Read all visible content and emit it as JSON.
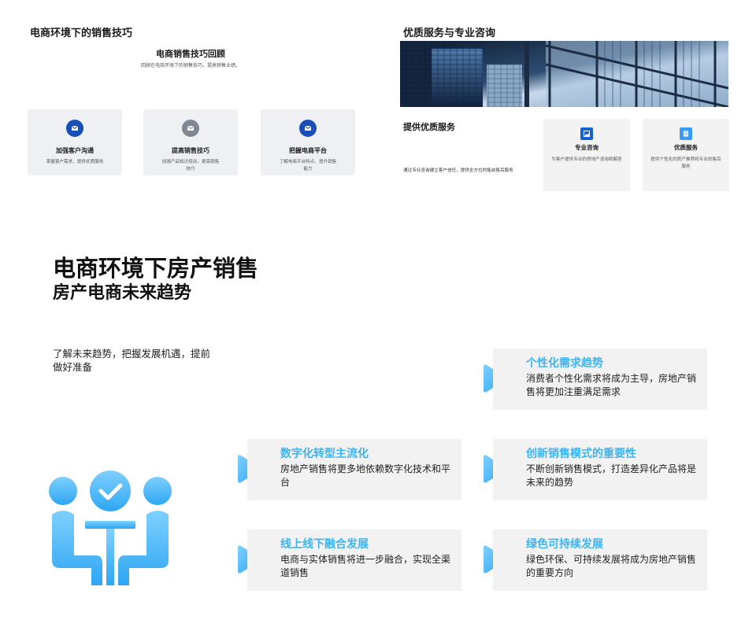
{
  "top_left": {
    "title": "电商环境下的销售技巧",
    "subtitle": "电商销售技巧回顾",
    "description": "回顾在电商环境下的销售技巧，提高销售业绩。",
    "cards": [
      {
        "title": "加强客户沟通",
        "desc": "掌握客户需求，提供优质服务",
        "icon": "mail-icon"
      },
      {
        "title": "提高销售技巧",
        "desc": "加强产品知识培训，提高销售技巧",
        "icon": "mail-icon"
      },
      {
        "title": "把握电商平台",
        "desc": "了解电商平台特点，提升销售能力",
        "icon": "mail-icon"
      }
    ]
  },
  "top_right": {
    "title": "优质服务与专业咨询",
    "heading": "提供优质服务",
    "text": "通过专业咨询建立客户信任，提供全方位的售前售后服务",
    "cards": [
      {
        "title": "专业咨询",
        "desc": "为客户提供专业的房地产咨询和解答",
        "icon": "image-icon"
      },
      {
        "title": "优质服务",
        "desc": "提供个性化的房产推荐和专业的售后服务",
        "icon": "document-icon"
      }
    ]
  },
  "bottom": {
    "title": "电商环境下房产销售",
    "subtitle": "房产电商未来趋势",
    "intro": "了解未来趋势，把握发展机遇，提前做好准备",
    "trends": [
      {
        "title": "个性化需求趋势",
        "desc": "消费者个性化需求将成为主导，房地产销售将更加注重满足需求"
      },
      {
        "title": "数字化转型主流化",
        "desc": "房地产销售将更多地依赖数字化技术和平台"
      },
      {
        "title": "创新销售模式的重要性",
        "desc": "不断创新销售模式，打造差异化产品将是未来的趋势"
      },
      {
        "title": "线上线下融合发展",
        "desc": "电商与实体销售将进一步融合，实现全渠道销售"
      },
      {
        "title": "绿色可持续发展",
        "desc": "绿色环保、可持续发展将成为房地产销售的重要方向"
      }
    ]
  },
  "colors": {
    "accent": "#3bb5f2",
    "dark_blue": "#1a4fb8",
    "card_bg": "#f2f2f2"
  }
}
